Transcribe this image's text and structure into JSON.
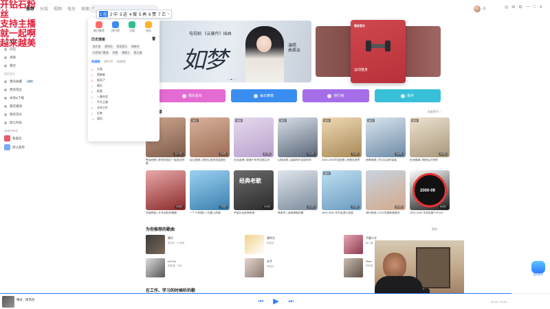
{
  "topnav": [
    "推荐",
    "乐馆",
    "视频",
    "电台",
    "探索"
  ],
  "search": {
    "value": ""
  },
  "ime": {
    "candidates": [
      "1 在",
      "2 中",
      "3 这",
      "4 做",
      "5 再",
      "6 赞",
      "7 乙"
    ],
    "selected": 0
  },
  "user": {
    "name": "小"
  },
  "window_icons": [
    "◎",
    "✉",
    "⚙",
    "—",
    "□",
    "✕"
  ],
  "overlay": [
    "开钻石粉丝",
    "支持主播",
    "就一起啊",
    "越来越美"
  ],
  "sidebar": {
    "items": [
      {
        "label": "推荐"
      },
      {
        "label": "乐馆"
      },
      {
        "label": "视频"
      },
      {
        "label": "雷达"
      }
    ],
    "section_mine": "我的音乐",
    "mine": [
      {
        "label": "我的收藏",
        "badge": "VIP"
      },
      {
        "label": "我的电台"
      },
      {
        "label": "本地&下载"
      },
      {
        "label": "最近播放"
      },
      {
        "label": "我的音乐"
      },
      {
        "label": "默认列表"
      }
    ],
    "section_playlists": "创建的歌单",
    "playlists": [
      {
        "label": "我喜欢",
        "color": "#e85a6c"
      },
      {
        "label": "默认歌单",
        "color": "#7aa9f5"
      }
    ]
  },
  "dropdown": {
    "icons": [
      {
        "label": "每日推荐",
        "color": "#ff6b6b"
      },
      {
        "label": "排行榜",
        "color": "#3a8df0"
      },
      {
        "label": "分类",
        "color": "#2fbf8f"
      },
      {
        "label": "电台",
        "color": "#ffb02e"
      }
    ],
    "history_title": "历史搜索",
    "history": [
      "洛天依",
      "周杰伦",
      "周深音乐",
      "林俊杰",
      "抖音热门歌曲",
      "热歌",
      "情歌王",
      "薛之谦"
    ],
    "tabs": [
      "热搜榜",
      "飙升榜",
      "新歌榜"
    ],
    "active_tab": 0,
    "list": [
      "大鱼",
      "孤勇者",
      "起风了",
      "晴天",
      "稻香",
      "一路向北",
      "平凡之路",
      "光年之外",
      "后来",
      "演员"
    ]
  },
  "banner": {
    "sub": "电视剧 《云襄传》插曲",
    "title": "如梦",
    "artist_line1": "演唱",
    "artist_line2": "曲美云",
    "side_card_tag": "健身音乐",
    "side_card_label": "运动健身"
  },
  "actions": [
    {
      "label": "猜你喜欢",
      "color": "#e36bd2"
    },
    {
      "label": "每日推荐",
      "color": "#3a8df0"
    },
    {
      "label": "排行榜",
      "color": "#a56ee8"
    },
    {
      "label": "歌手",
      "color": "#39c0d9"
    }
  ],
  "recommend": {
    "title": "推荐歌单",
    "more": "查看更多 >",
    "row1": [
      {
        "title": "粤语经典 | 那些年我们一起追过的歌",
        "plays": "12.7万",
        "badge": "",
        "colors": [
          "#cfa68e",
          "#7b5b4a"
        ]
      },
      {
        "title": "夏日甜歌 | 甜到心里的恋爱曲目",
        "plays": "2.5万",
        "badge": "官方",
        "colors": [
          "#d9b29c",
          "#9b6c55"
        ]
      },
      {
        "title": "古风国潮 | 穿越千年的古韵之声",
        "plays": "6.7万",
        "badge": "专属",
        "colors": [
          "#e7d9ef",
          "#b8a1cc"
        ]
      },
      {
        "title": "心情治愈 | 温柔的声音陪伴你",
        "plays": "5.1万",
        "badge": "官方",
        "colors": [
          "#d7dfe8",
          "#5a6677"
        ]
      },
      {
        "title": "2000-2009华语金曲 | 经典永流传",
        "plays": "3.3万",
        "badge": "官方",
        "colors": [
          "#efd9b4",
          "#a88957"
        ]
      },
      {
        "title": "经典老歌 | 岁月沉淀的温柔",
        "plays": "5.8万",
        "badge": "官方",
        "colors": [
          "#d9e6f0",
          "#6e8aa6"
        ]
      },
      {
        "title": "民谣故事 | 唱给远方的你",
        "plays": "4.0万",
        "badge": "官方",
        "colors": [
          "#ede3d0",
          "#a7957a"
        ]
      }
    ],
    "row2": [
      {
        "title": "车载热歌 | 开车必听的嗨曲",
        "plays": "3.8万",
        "badge": "",
        "colors": [
          "#e9a8a8",
          "#8a2a2a"
        ]
      },
      {
        "title": "一个人的旅行 | 在路上的歌",
        "plays": "7.5万",
        "badge": "",
        "colors": [
          "#9bd1f2",
          "#3b7fae"
        ]
      },
      {
        "title": "中国乐坛经典老歌",
        "plays": "9.0万",
        "badge": "",
        "colors": [
          "#6b6b6b",
          "#2b2b2b"
        ]
      },
      {
        "title": "林俊杰 | 深情演唱合集",
        "plays": "2.2万",
        "badge": "",
        "colors": [
          "#dfe6ee",
          "#7c8a9a"
        ]
      },
      {
        "title": "2000-2009 年华语流行金曲",
        "plays": "1.9万",
        "badge": "官方",
        "colors": [
          "#bfe0f2",
          "#6b9bc0"
        ]
      },
      {
        "title": "流行新歌 | 2021年度新歌推荐",
        "plays": "3.4万",
        "badge": "",
        "colors": [
          "#c8d3e0",
          "#d3a98b"
        ]
      },
      {
        "title": "2000-2009 华语金曲TOP100",
        "plays": "8.6万",
        "badge": "",
        "colors": [
          "#ffffff",
          "#1a1a1a"
        ]
      }
    ],
    "row2_overlay": "经典老歌",
    "vinyl_text": "2000-09"
  },
  "foryou": {
    "title": "为你推荐的歌曲",
    "more": "播放",
    "items": [
      {
        "title": "晴天",
        "artist": "周杰伦 · 叶惠美",
        "colors": [
          "#3b3b3b",
          "#7b6a5a"
        ]
      },
      {
        "title": "我的天",
        "artist": "陈奕迅",
        "colors": [
          "#f1d28a",
          "#ffffff"
        ]
      },
      {
        "title": "不要小半",
        "artist": "薛之谦",
        "colors": [
          "#e8a6b6",
          "#8a3a4e"
        ]
      },
      {
        "title": "Let Go",
        "artist": "张韶涵 · 汉化",
        "colors": [
          "#dddddd",
          "#555555"
        ]
      },
      {
        "title": "水手",
        "artist": "郑智化",
        "colors": [
          "#e4d6ce",
          "#8a7a72"
        ]
      },
      {
        "title": "Over",
        "artist": "林宥嘉",
        "colors": [
          "#c9bdb0",
          "#5d5048"
        ]
      }
    ]
  },
  "section_work": "在工作、学习的时候听的歌",
  "player": {
    "song": "晴天 - 周杰伦",
    "time": "00:00 / 04:29",
    "progress_percent": 93
  },
  "assistant_label": "音乐助手"
}
